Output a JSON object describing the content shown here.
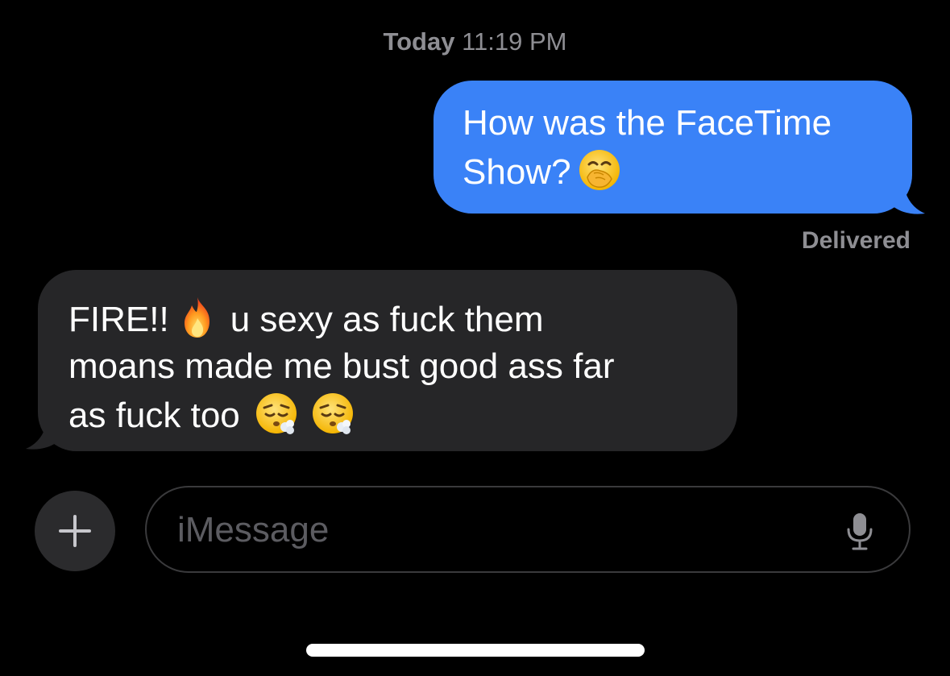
{
  "header": {
    "day": "Today",
    "time": "11:19 PM"
  },
  "messages": [
    {
      "direction": "outgoing",
      "lines": [
        "How was the FaceTime",
        "Show?"
      ],
      "emojis": [
        "face-with-hand-over-mouth"
      ],
      "bubble_color": "#3a82f7",
      "status": "Delivered"
    },
    {
      "direction": "incoming",
      "lines": [
        "FIRE!!",
        "u sexy as fuck them",
        "moans made me bust good ass far",
        "as fuck too"
      ],
      "emojis": [
        "fire",
        "face-exhaling",
        "face-exhaling"
      ],
      "bubble_color": "#262628"
    }
  ],
  "composer": {
    "placeholder": "iMessage",
    "add_icon": "plus-icon",
    "mic_icon": "microphone-icon"
  },
  "colors": {
    "background": "#000000",
    "meta_text": "#8e8e93",
    "input_border": "#3a3a3c"
  }
}
